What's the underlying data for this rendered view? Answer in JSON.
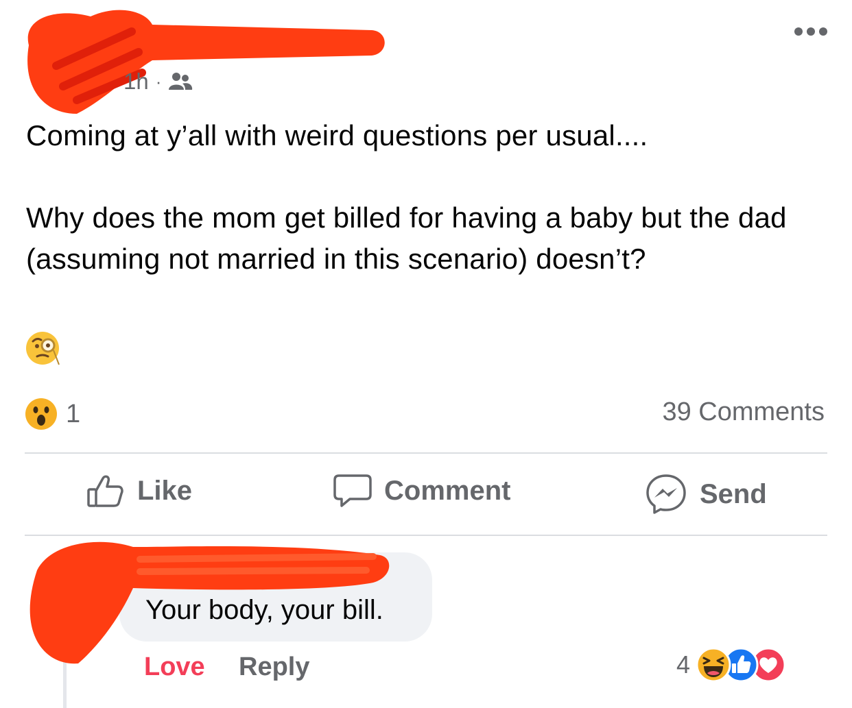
{
  "post": {
    "time": "1h",
    "separator": "·",
    "audience_icon": "friends-icon",
    "more_icon": "more-dots-icon",
    "text_line1": "Coming at y’all with weird questions per usual....",
    "text_line2": "Why does the mom get billed for having a baby but the dad (assuming not married in this scenario) doesn’t?",
    "emoji": "face-with-monocle"
  },
  "reactions": {
    "icon": "wow-reaction",
    "count": "1",
    "comments": "39 Comments"
  },
  "actions": {
    "like": "Like",
    "comment": "Comment",
    "send": "Send"
  },
  "comment": {
    "text": "Your body, your bill.",
    "love": "Love",
    "reply": "Reply",
    "reaction_count": "4",
    "reaction_icons": [
      "haha",
      "like",
      "love"
    ]
  },
  "colors": {
    "redaction": "#ff3d12",
    "love": "#f33e58",
    "like": "#1877f2",
    "muted": "#65676b"
  }
}
